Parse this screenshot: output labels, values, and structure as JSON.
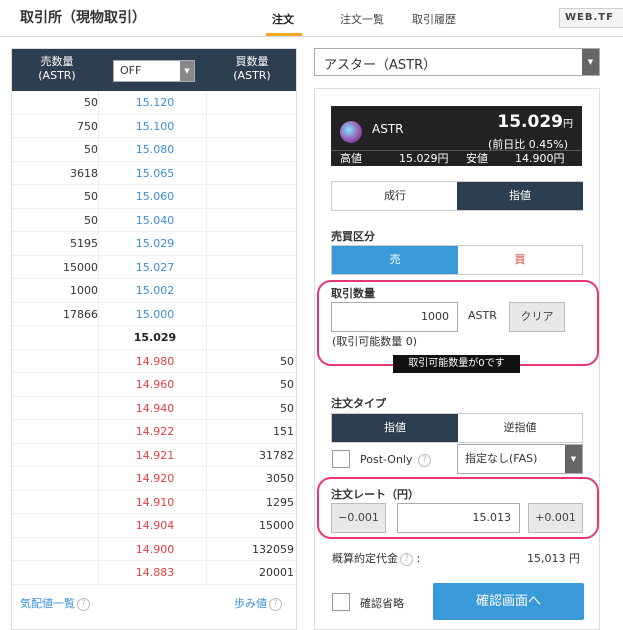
{
  "header": {
    "title": "取引所（現物取引）",
    "tabs": [
      "注文",
      "注文一覧",
      "取引履歴"
    ],
    "logo": "WEB.TF"
  },
  "orderbook": {
    "col_sell": "売数量\n(ASTR)",
    "col_buy": "買数量\n(ASTR)",
    "select_value": "OFF",
    "rows": [
      {
        "sell": "50",
        "price": "15.120",
        "buy": "",
        "side": "ask"
      },
      {
        "sell": "750",
        "price": "15.100",
        "buy": "",
        "side": "ask"
      },
      {
        "sell": "50",
        "price": "15.080",
        "buy": "",
        "side": "ask"
      },
      {
        "sell": "3618",
        "price": "15.065",
        "buy": "",
        "side": "ask"
      },
      {
        "sell": "50",
        "price": "15.060",
        "buy": "",
        "side": "ask"
      },
      {
        "sell": "50",
        "price": "15.040",
        "buy": "",
        "side": "ask"
      },
      {
        "sell": "5195",
        "price": "15.029",
        "buy": "",
        "side": "ask"
      },
      {
        "sell": "15000",
        "price": "15.027",
        "buy": "",
        "side": "ask"
      },
      {
        "sell": "1000",
        "price": "15.002",
        "buy": "",
        "side": "ask"
      },
      {
        "sell": "17866",
        "price": "15.000",
        "buy": "",
        "side": "ask"
      },
      {
        "sell": "",
        "price": "15.029",
        "buy": "",
        "side": "mid"
      },
      {
        "sell": "",
        "price": "14.980",
        "buy": "50",
        "side": "bid"
      },
      {
        "sell": "",
        "price": "14.960",
        "buy": "50",
        "side": "bid"
      },
      {
        "sell": "",
        "price": "14.940",
        "buy": "50",
        "side": "bid"
      },
      {
        "sell": "",
        "price": "14.922",
        "buy": "151",
        "side": "bid"
      },
      {
        "sell": "",
        "price": "14.921",
        "buy": "31782",
        "side": "bid"
      },
      {
        "sell": "",
        "price": "14.920",
        "buy": "3050",
        "side": "bid"
      },
      {
        "sell": "",
        "price": "14.910",
        "buy": "1295",
        "side": "bid"
      },
      {
        "sell": "",
        "price": "14.904",
        "buy": "15000",
        "side": "bid"
      },
      {
        "sell": "",
        "price": "14.900",
        "buy": "132059",
        "side": "bid"
      },
      {
        "sell": "",
        "price": "14.883",
        "buy": "20001",
        "side": "bid"
      }
    ],
    "footer_left": "気配値一覧",
    "footer_right": "歩み値"
  },
  "pair_select": "アスター（ASTR）",
  "ticker": {
    "symbol": "ASTR",
    "price": "15.029",
    "price_unit": "円",
    "change": "(前日比 0.45%)",
    "high_label": "高値",
    "high_value": "15.029円",
    "low_label": "安値",
    "low_value": "14.900円"
  },
  "order_type_tabs": [
    "成行",
    "指値"
  ],
  "side": {
    "label": "売買区分",
    "sell": "売",
    "buy": "買"
  },
  "quantity": {
    "label": "取引数量",
    "value": "1000",
    "unit": "ASTR",
    "clear": "クリア",
    "available": "(取引可能数量 0)",
    "tooltip": "取引可能数量が0です"
  },
  "order_kind": {
    "label": "注文タイプ",
    "tabs": [
      "指値",
      "逆指値"
    ],
    "post_only": "Post-Only",
    "tif": "指定なし(FAS)"
  },
  "rate": {
    "label": "注文レート（円）",
    "minus": "−0.001",
    "value": "15.013",
    "plus": "+0.001"
  },
  "estimate": {
    "label": "概算約定代金",
    "value": "15,013 円"
  },
  "confirm_skip": "確認省略",
  "confirm_button": "確認画面へ",
  "colors": {
    "navy": "#2c3e50",
    "ask": "#3a8fd8",
    "bid": "#e04040",
    "highlight": "#e8367a",
    "accent": "#f5a623",
    "cta": "#3a9ad9"
  }
}
